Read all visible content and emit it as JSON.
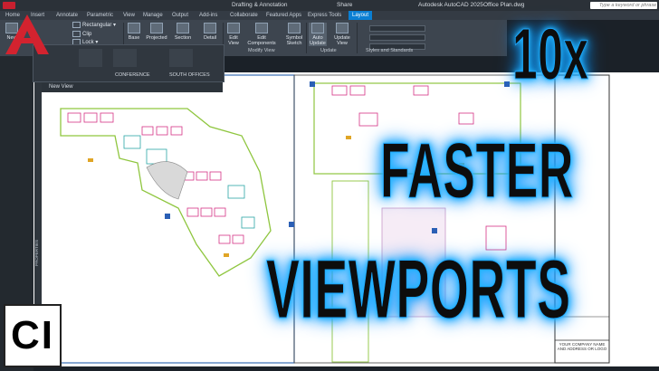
{
  "titlebar": {
    "workspace": "Drafting & Annotation",
    "share": "Share",
    "app_title": "Autodesk AutoCAD 2025",
    "file_name": "Office Plan.dwg",
    "search_placeholder": "Type a keyword or phrase"
  },
  "ribbon": {
    "tabs": [
      "Home",
      "Insert",
      "Annotate",
      "Parametric",
      "View",
      "Manage",
      "Output",
      "Add-ins",
      "Collaborate",
      "Featured Apps",
      "Express Tools",
      "Layout"
    ],
    "active_tab": "Layout",
    "buttons": {
      "new": "New",
      "rectangular": "Rectangular",
      "clip": "Clip",
      "lock": "Lock",
      "base": "Base",
      "projected": "Projected",
      "section": "Section",
      "detail": "Detail",
      "edit_view": "Edit View",
      "edit_components": "Edit Components",
      "symbol_sketch": "Symbol Sketch",
      "auto_update": "Auto Update",
      "update_view": "Update View"
    },
    "panels": {
      "modify_view": "Modify View",
      "update": "Update",
      "styles": "Styles and Standards"
    }
  },
  "views_popup": {
    "items": [
      "CONFERENCE",
      "SOUTH OFFICES"
    ],
    "new_view": "New View"
  },
  "properties_label": "PROPERTIES",
  "headline": {
    "line1": "10x",
    "line2": "FASTER",
    "line3": "VIEWPORTS"
  },
  "channel_logo": "CI",
  "title_block": "YOUR COMPANY NAME AND ADDRESS OR LOGO",
  "colors": {
    "glow": "#1ca7ff",
    "autocad_red": "#c8202f",
    "accent_tab": "#0a7fd3"
  }
}
